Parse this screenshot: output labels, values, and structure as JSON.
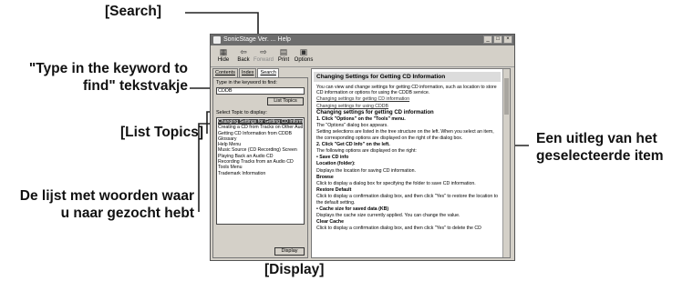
{
  "callouts": {
    "search": "[Search]",
    "keyword_line1": "\"Type in the keyword to",
    "keyword_line2": "find\" tekstvakje",
    "list_topics": "[List Topics]",
    "wordlist_line1": "De lijst met woorden waar",
    "wordlist_line2": "u naar gezocht hebt",
    "display": "[Display]",
    "explanation_line1": "Een uitleg van het",
    "explanation_line2": "geselecteerde item"
  },
  "window": {
    "title": "SonicStage Ver. ... Help",
    "toolbar": [
      "Hide",
      "Back",
      "Forward",
      "Print",
      "Options"
    ],
    "tabs": [
      "Contents",
      "Index",
      "Search"
    ],
    "keyword_label": "Type in the keyword to find:",
    "keyword_value": "CDDB",
    "list_topics_button": "List Topics",
    "select_topic_label": "Select Topic to display:",
    "topics": [
      "Changing Settings for Getting CD Information",
      "Creating a CD from Tracks on Other Audio ...",
      "Getting CD Information from CDDB",
      "Glossary",
      "Help Menu",
      "Music Source (CD Recording) Screen",
      "Playing Back an Audio CD",
      "Recording Tracks from an Audio CD",
      "Tools Menu",
      "Trademark Information"
    ],
    "display_button": "Display"
  },
  "content": {
    "heading": "Changing Settings for Getting CD Information",
    "intro": "You can view and change settings for getting CD information, such as location to store CD information or options for using the CDDB service.",
    "link1": "Changing settings for getting CD information",
    "link2": "Changing settings for using CDDB",
    "subheading": "Changing settings for getting CD information",
    "step1_title": "1.  Click \"Options\" on the \"Tools\" menu.",
    "step1_text1": "The \"Options\" dialog box appears.",
    "step1_text2": "Setting selections are listed in the tree structure on the left. When you select an item, the corresponding options are displayed on the right of the dialog box.",
    "step2_title": "2.  Click \"Get CD Info\" on the left.",
    "step2_text": "The following options are displayed on the right:",
    "b1": "Save CD info",
    "b1_location": "Location (folder):",
    "b1_location_text": "Displays the location for saving CD information.",
    "b1_browse": "Browse",
    "b1_browse_text": "Click to display a dialog box for specifying the folder to save CD information.",
    "b1_restore": "Restore Default",
    "b1_restore_text": "Click to display a confirmation dialog box, and then click \"Yes\" to restore the location to the default setting.",
    "b2": "Cache size for saved data (KB)",
    "b2_text": "Displays the cache size currently applied. You can change the value.",
    "b2_clear": "Clear Cache",
    "b2_clear_text": "Click to display a confirmation dialog box, and then click \"Yes\" to delete the CD"
  }
}
